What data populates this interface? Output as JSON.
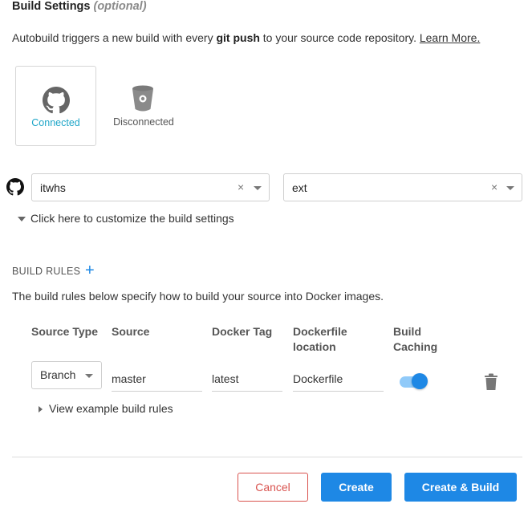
{
  "section": {
    "title": "Build Settings",
    "optional": "(optional)",
    "desc_prefix": "Autobuild triggers a new build with every ",
    "desc_bold": "git push",
    "desc_suffix": " to your source code repository. ",
    "learn_more": "Learn More."
  },
  "providers": [
    {
      "label": "Connected",
      "icon": "github-icon",
      "color": "#1fa6c8"
    },
    {
      "label": "Disconnected",
      "icon": "bitbucket-icon",
      "color": "#555555"
    }
  ],
  "repo": {
    "organization": "itwhs",
    "repository": "ext",
    "clear_glyph": "×"
  },
  "customize_link": "Click here to customize the build settings",
  "build_rules": {
    "heading": "BUILD RULES",
    "add_glyph": "+",
    "description": "The build rules below specify how to build your source into Docker images.",
    "columns": [
      "Source Type",
      "Source",
      "Docker Tag",
      "Dockerfile location",
      "Build Caching"
    ],
    "rows": [
      {
        "source_type": "Branch",
        "source": "master",
        "docker_tag": "latest",
        "dockerfile": "Dockerfile",
        "build_caching": true
      }
    ],
    "example_link": "View example build rules"
  },
  "actions": {
    "cancel": "Cancel",
    "create": "Create",
    "create_build": "Create & Build"
  },
  "colors": {
    "accent": "#1e88e5",
    "connected": "#1fa6c8",
    "danger": "#d9534f"
  }
}
